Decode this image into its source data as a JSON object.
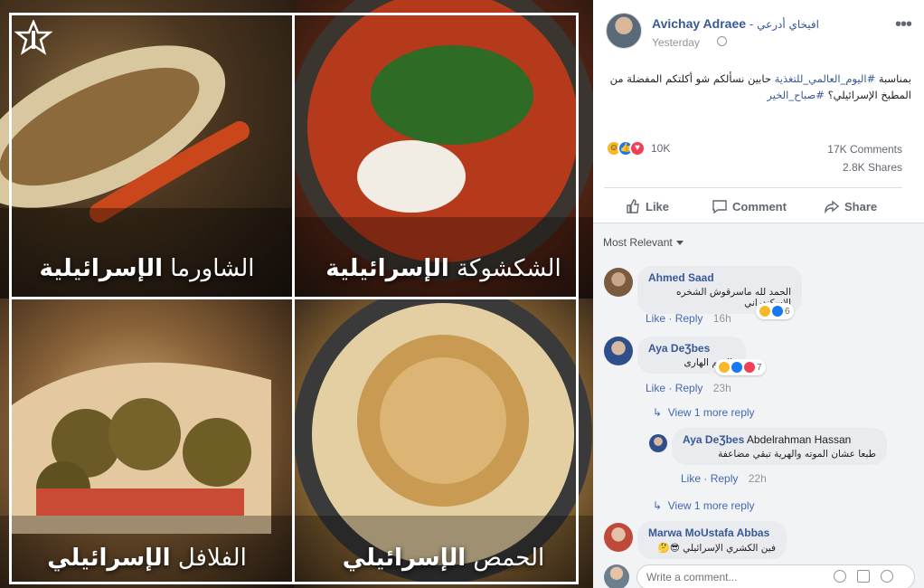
{
  "photo": {
    "captions": [
      {
        "light": "الشاورما",
        "bold": "الإسرائيلية"
      },
      {
        "light": "الشكشوكة",
        "bold": "الإسرائيلية"
      },
      {
        "light": "الفلافل",
        "bold": "الإسرائيلي"
      },
      {
        "light": "الحمص",
        "bold": "الإسرائيلي"
      }
    ],
    "logo_icon": "idf-emblem-icon"
  },
  "post": {
    "author": "Avichay Adraee",
    "author_alt": "- افيخاي أدرعي",
    "time": "Yesterday",
    "text_prefix": "بمناسبة",
    "hashtag1": "#اليوم_العالمي_للتغذية",
    "text_mid": "حابين نسألكم شو أكلتكم المفضلة من المطبخ الإسرائيلي؟",
    "hashtag2": "#صباح_الخير",
    "reaction_count": "10K",
    "comments_count": "17K Comments",
    "shares_count": "2.8K Shares"
  },
  "actions": {
    "like": "Like",
    "comment": "Comment",
    "share": "Share"
  },
  "sort": {
    "label": "Most Relevant"
  },
  "comments": [
    {
      "name": "Ahmed Saad",
      "text": "الحمد لله ماسرقوش الشخره الاسكندراني",
      "like": "Like",
      "reply": "Reply",
      "time": "16h",
      "react_count": "6"
    },
    {
      "name": "Aya DeƷbes",
      "text": "بالسم الهارى",
      "like": "Like",
      "reply": "Reply",
      "time": "23h",
      "react_count": "7",
      "view_replies": "View 1 more reply"
    },
    {
      "name": "Aya DeƷbes",
      "mention": "Abdelrahman Hassan",
      "text": "طبعا عشان الموته والهرية تبقي مضاعفة",
      "like": "Like",
      "reply": "Reply",
      "time": "22h",
      "view_replies": "View 1 more reply"
    },
    {
      "name": "Marwa MoUstafa Abbas",
      "text": "فين الكشري الإسرائيلي 😎🤔"
    }
  ],
  "composer": {
    "placeholder": "Write a comment..."
  },
  "colors": {
    "link": "#385898",
    "bg": "#f2f3f5",
    "like_blue": "#1877f2",
    "love_red": "#f33e58",
    "haha_yellow": "#f7b928"
  }
}
